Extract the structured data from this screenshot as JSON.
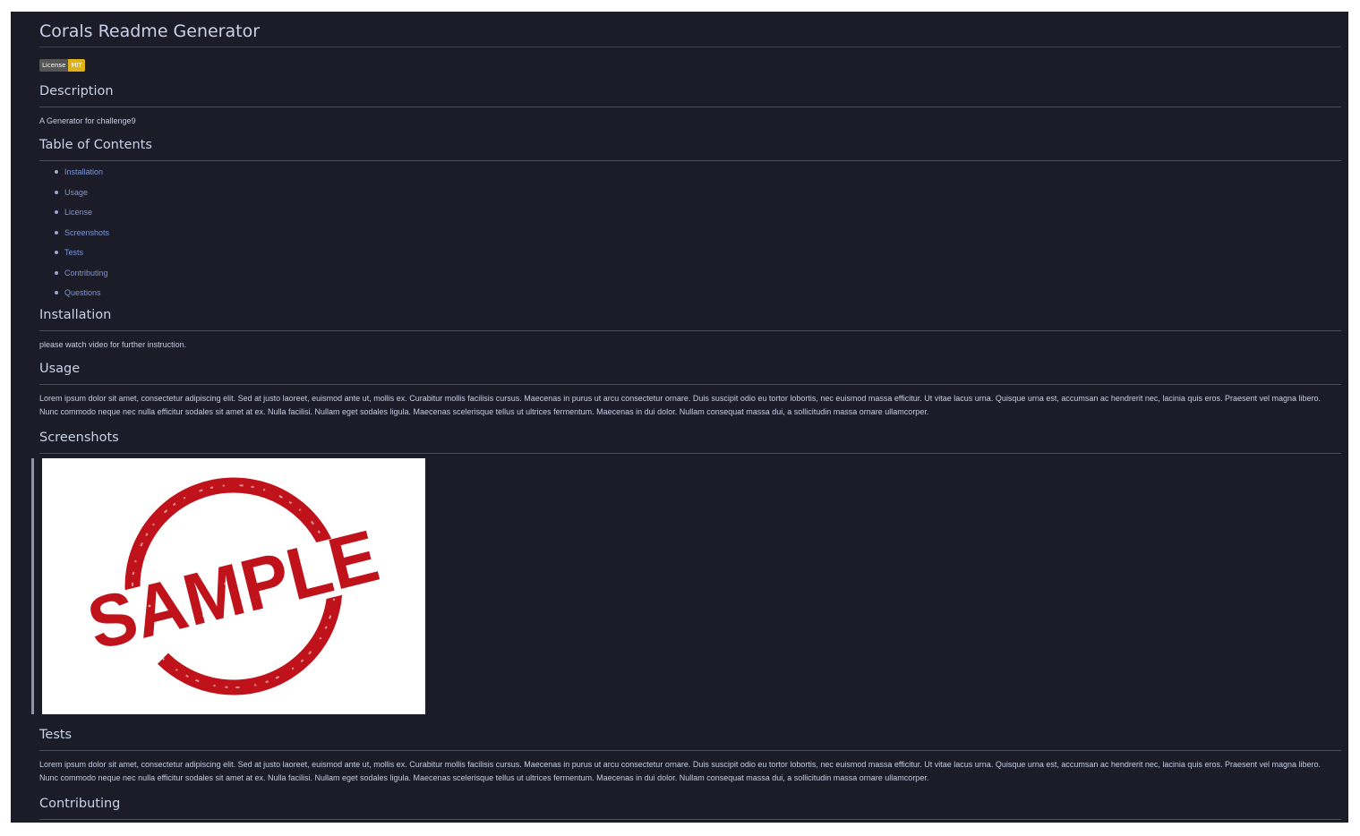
{
  "readme": {
    "title": "Corals Readme Generator",
    "badge": {
      "label": "License",
      "value": "MIT",
      "label_color": "#555555",
      "value_color": "#dfb317"
    },
    "description": {
      "heading": "Description",
      "text": "A Generator for challenge9"
    },
    "toc": {
      "heading": "Table of Contents",
      "items": [
        "Installation",
        "Usage",
        "License",
        "Screenshots",
        "Tests",
        "Contributing",
        "Questions"
      ]
    },
    "installation": {
      "heading": "Installation",
      "text": "please watch video for further instruction."
    },
    "usage": {
      "heading": "Usage",
      "text": "Lorem ipsum dolor sit amet, consectetur adipiscing elit. Sed at justo laoreet, euismod ante ut, mollis ex. Curabitur mollis facilisis cursus. Maecenas in purus ut arcu consectetur ornare. Duis suscipit odio eu tortor lobortis, nec euismod massa efficitur. Ut vitae lacus urna. Quisque urna est, accumsan ac hendrerit nec, lacinia quis eros. Praesent vel magna libero. Nunc commodo neque nec nulla efficitur sodales sit amet at ex. Nulla facilisi. Nullam eget sodales ligula. Maecenas scelerisque tellus ut ultrices fermentum. Maecenas in dui dolor. Nullam consequat massa dui, a sollicitudin massa ornare ullamcorper."
    },
    "screenshots": {
      "heading": "Screenshots",
      "image_text": "SAMPLE",
      "stamp_color": "#c0121a"
    },
    "tests": {
      "heading": "Tests",
      "text": "Lorem ipsum dolor sit amet, consectetur adipiscing elit. Sed at justo laoreet, euismod ante ut, mollis ex. Curabitur mollis facilisis cursus. Maecenas in purus ut arcu consectetur ornare. Duis suscipit odio eu tortor lobortis, nec euismod massa efficitur. Ut vitae lacus urna. Quisque urna est, accumsan ac hendrerit nec, lacinia quis eros. Praesent vel magna libero. Nunc commodo neque nec nulla efficitur sodales sit amet at ex. Nulla facilisi. Nullam eget sodales ligula. Maecenas scelerisque tellus ut ultrices fermentum. Maecenas in dui dolor. Nullam consequat massa dui, a sollicitudin massa ornare ullamcorper."
    },
    "contributing": {
      "heading": "Contributing"
    }
  },
  "colors": {
    "page_bg": "#1c1c28",
    "heading": "#c9d1e8",
    "link": "#7a95d6",
    "text": "#c5cbe0"
  }
}
